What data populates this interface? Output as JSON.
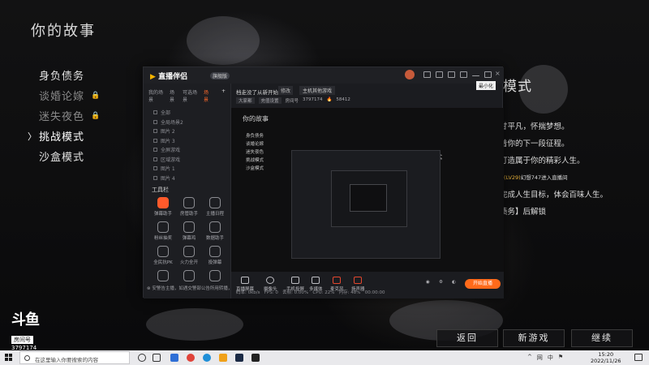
{
  "game": {
    "title": "你的故事",
    "menu": [
      {
        "label": "身负债务",
        "state": "normal"
      },
      {
        "label": "谈婚论嫁",
        "state": "locked"
      },
      {
        "label": "迷失夜色",
        "state": "locked"
      },
      {
        "label": "挑战模式",
        "state": "active"
      },
      {
        "label": "沙盒模式",
        "state": "normal"
      }
    ],
    "active_arrow": "〉",
    "lock_icon": "lock-icon",
    "mode_title": "模式",
    "mode_desc": {
      "line1": "甘平凡，怀揣梦想。",
      "line2": "着你的下一段征程。",
      "line3": "打造属于你的精彩人生。",
      "line4_prefix": "欢迎",
      "line4_user": "(LV29)",
      "line4_rest": "幻想747进入直播间",
      "line5": "完成人生目标，体会百味人生。",
      "line6": "债务】后解锁"
    },
    "buttons": {
      "back": "返回",
      "new_game": "新游戏",
      "continue": "继续"
    }
  },
  "watermark": {
    "brand": "斗鱼",
    "tag": "房间号",
    "room": "3797174"
  },
  "app": {
    "logo": "直播伴侣",
    "badge": "旗舰版",
    "tooltip": "最小化",
    "tabs": [
      "我的场景",
      "场景",
      "可选场景",
      "场景"
    ],
    "scenes": [
      "全部",
      "全局场景2",
      "图片 2",
      "图片 3",
      "全屏游戏",
      "区域游戏",
      "图片 1",
      "图片 4"
    ],
    "tools_title": "工具栏",
    "tools": [
      "弹幕助手",
      "房管助手",
      "主播日程",
      "粉丝抽奖",
      "弹幕鸡",
      "数据助手",
      "全民抗PK",
      "火力全开",
      "投弹幕",
      "",
      "",
      ""
    ],
    "stream_title": "档走没了从新开始",
    "stream_edit": "修改",
    "stream_category": "主机其他游戏",
    "room_row": {
      "mode": "大家都",
      "plan": "充值设置",
      "room_label": "房间号",
      "room_id": "3797174",
      "fans_label": "",
      "fans": "58412"
    },
    "preview": {
      "title": "你的故事",
      "menu": [
        "身负债务",
        "谈婚论嫁",
        "迷失夜色",
        "挑战模式",
        "沙盒模式"
      ],
      "mode": "模式"
    },
    "bottom_tools": [
      "直播屏幕",
      "摄像头",
      "手机投屏",
      "多媒体",
      "麦克风",
      "扬声器"
    ],
    "live_button": "开始直播",
    "notice": "⊗ 安警告主播，如遇交警部公告所用转播，请立即核对查询看",
    "status": {
      "bitrate": "码率: 0kb/s",
      "fps": "FPS: 0",
      "drop": "丢帧: 0.00%",
      "cpu": "CPU: 22%",
      "mem": "内存: 48%",
      "time": "00:00:00"
    }
  },
  "taskbar": {
    "search_placeholder": "在这里输入你要搜索的内容",
    "tray": [
      "^",
      "网",
      "中",
      "⚑"
    ],
    "time": "15:20",
    "date": "2022/11/26"
  }
}
